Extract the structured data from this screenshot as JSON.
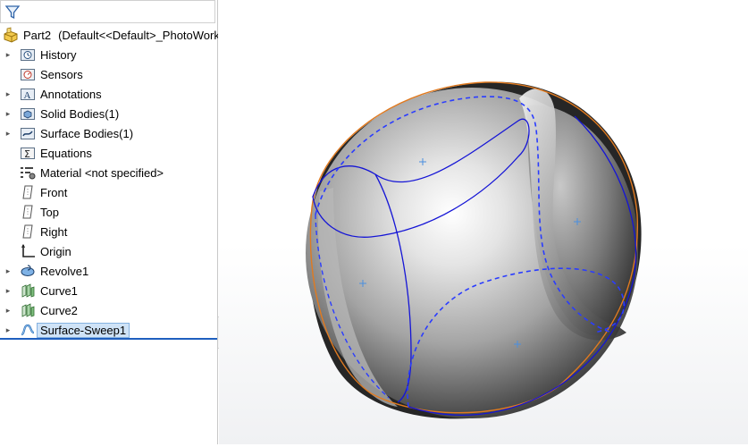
{
  "part": {
    "name": "Part2",
    "config": "(Default<<Default>_PhotoWork"
  },
  "tree": [
    {
      "label": "History",
      "icon": "history-folder-icon",
      "expandable": true
    },
    {
      "label": "Sensors",
      "icon": "sensor-icon",
      "expandable": false
    },
    {
      "label": "Annotations",
      "icon": "annotations-icon",
      "expandable": true
    },
    {
      "label": "Solid Bodies(1)",
      "icon": "solid-bodies-icon",
      "expandable": true
    },
    {
      "label": "Surface Bodies(1)",
      "icon": "surface-bodies-icon",
      "expandable": true
    },
    {
      "label": "Equations",
      "icon": "equations-icon",
      "expandable": false
    },
    {
      "label": "Material <not specified>",
      "icon": "material-icon",
      "expandable": false
    },
    {
      "label": "Front",
      "icon": "plane-icon",
      "expandable": false
    },
    {
      "label": "Top",
      "icon": "plane-icon",
      "expandable": false
    },
    {
      "label": "Right",
      "icon": "plane-icon",
      "expandable": false
    },
    {
      "label": "Origin",
      "icon": "origin-icon",
      "expandable": false
    },
    {
      "label": "Revolve1",
      "icon": "revolve-icon",
      "expandable": true
    },
    {
      "label": "Curve1",
      "icon": "curve-icon",
      "expandable": true
    },
    {
      "label": "Curve2",
      "icon": "curve-icon",
      "expandable": true
    },
    {
      "label": "Surface-Sweep1",
      "icon": "sweep-icon",
      "expandable": true,
      "selected": true
    }
  ],
  "colors": {
    "selection": "#cfe3f7",
    "curve_solid": "#1515d6",
    "curve_dashed": "#2a3cff",
    "silhouette": "#e07a20"
  }
}
